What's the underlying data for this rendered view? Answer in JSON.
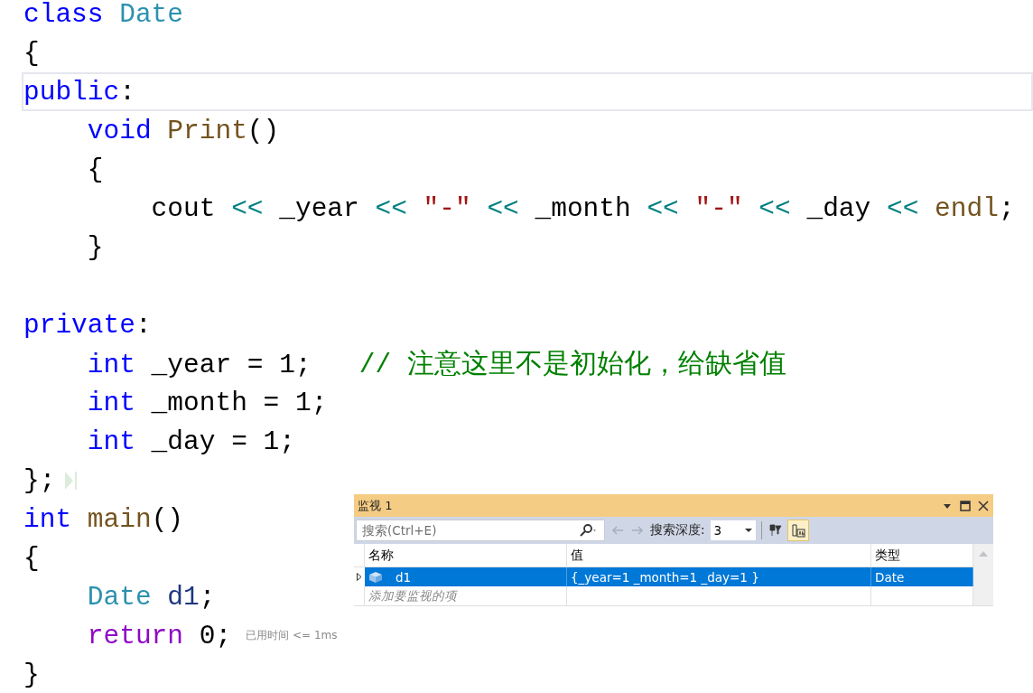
{
  "editor": {
    "lines": [
      {
        "current": false,
        "marker": false,
        "tokens": [
          {
            "kind": "keyword",
            "text": "class"
          },
          {
            "kind": "type",
            "text": " Date"
          }
        ]
      },
      {
        "current": false,
        "marker": false,
        "tokens": [
          {
            "kind": "plain",
            "text": "{"
          }
        ]
      },
      {
        "current": true,
        "marker": false,
        "tokens": [
          {
            "kind": "keyword",
            "text": "public"
          },
          {
            "kind": "plain",
            "text": ":"
          }
        ]
      },
      {
        "current": false,
        "marker": false,
        "tokens": [
          {
            "kind": "keyword",
            "text": "    void"
          },
          {
            "kind": "func",
            "text": " Print"
          },
          {
            "kind": "plain",
            "text": "()"
          }
        ]
      },
      {
        "current": false,
        "marker": false,
        "tokens": [
          {
            "kind": "plain",
            "text": "    {"
          }
        ]
      },
      {
        "current": false,
        "marker": false,
        "tokens": [
          {
            "kind": "plain",
            "text": "        cout "
          },
          {
            "kind": "op",
            "text": "<<"
          },
          {
            "kind": "plain",
            "text": " _year "
          },
          {
            "kind": "op",
            "text": "<<"
          },
          {
            "kind": "string",
            "text": " \"-\" "
          },
          {
            "kind": "op",
            "text": "<<"
          },
          {
            "kind": "plain",
            "text": " _month "
          },
          {
            "kind": "op",
            "text": "<<"
          },
          {
            "kind": "string",
            "text": " \"-\" "
          },
          {
            "kind": "op",
            "text": "<<"
          },
          {
            "kind": "plain",
            "text": " _day "
          },
          {
            "kind": "op",
            "text": "<<"
          },
          {
            "kind": "func",
            "text": " endl"
          },
          {
            "kind": "plain",
            "text": ";"
          }
        ]
      },
      {
        "current": false,
        "marker": false,
        "tokens": [
          {
            "kind": "plain",
            "text": "    }"
          }
        ]
      },
      {
        "current": false,
        "marker": false
      },
      {
        "current": false,
        "marker": false,
        "tokens": [
          {
            "kind": "keyword",
            "text": "private"
          },
          {
            "kind": "plain",
            "text": ":"
          }
        ]
      },
      {
        "current": false,
        "marker": false,
        "tokens": [
          {
            "kind": "keyword",
            "text": "    int"
          },
          {
            "kind": "plain",
            "text": " _year = 1;   "
          },
          {
            "kind": "comment",
            "text": "// 注意这里不是初始化，给缺省值"
          }
        ]
      },
      {
        "current": false,
        "marker": false,
        "tokens": [
          {
            "kind": "keyword",
            "text": "    int"
          },
          {
            "kind": "plain",
            "text": " _month = 1;"
          }
        ]
      },
      {
        "current": false,
        "marker": false,
        "tokens": [
          {
            "kind": "keyword",
            "text": "    int"
          },
          {
            "kind": "plain",
            "text": " _day = 1;"
          }
        ]
      },
      {
        "current": false,
        "marker": true,
        "tokens": [
          {
            "kind": "plain",
            "text": "};"
          }
        ]
      },
      {
        "current": false,
        "marker": false,
        "tokens": [
          {
            "kind": "keyword",
            "text": "int"
          },
          {
            "kind": "func",
            "text": " main"
          },
          {
            "kind": "plain",
            "text": "()"
          }
        ]
      },
      {
        "current": false,
        "marker": false,
        "tokens": [
          {
            "kind": "plain",
            "text": "{"
          }
        ]
      },
      {
        "current": false,
        "marker": false,
        "tokens": [
          {
            "kind": "type",
            "text": "    Date"
          },
          {
            "kind": "local",
            "text": " d1"
          },
          {
            "kind": "plain",
            "text": ";"
          }
        ]
      },
      {
        "current": false,
        "marker": false,
        "tokens": [
          {
            "kind": "control",
            "text": "    return"
          },
          {
            "kind": "plain",
            "text": " 0;"
          }
        ],
        "hint": "已用时间 <= 1ms"
      },
      {
        "current": false,
        "marker": false,
        "tokens": [
          {
            "kind": "plain",
            "text": "}"
          }
        ]
      }
    ]
  },
  "watch_window": {
    "title": "监视 1",
    "search": {
      "placeholder": "搜索(Ctrl+E)"
    },
    "depth_label": "搜索深度:",
    "depth_value": "3",
    "hex_toggle": {
      "selected": true
    },
    "columns": [
      "名称",
      "值",
      "类型"
    ],
    "rows": [
      {
        "name": "d1",
        "value": "{_year=1 _month=1 _day=1 }",
        "type": "Date",
        "selected": true
      }
    ],
    "add_placeholder": "添加要监视的项"
  }
}
